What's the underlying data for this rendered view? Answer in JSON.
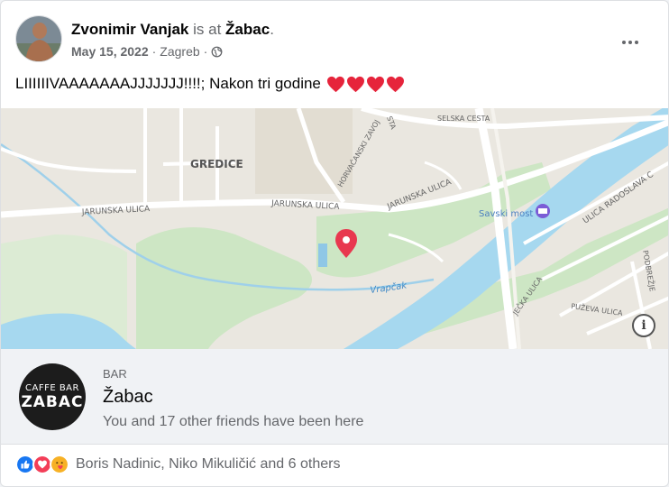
{
  "post": {
    "author": "Zvonimir Vanjak",
    "is_at": "is at",
    "place": "Žabac",
    "period": ".",
    "date": "May 15, 2022",
    "separator": "·",
    "city": "Zagreb",
    "separator2": "·",
    "text": "LIIIIIIVAAAAAAAJJJJJJJ!!!!; Nakon tri godine",
    "hearts_count": 4
  },
  "map": {
    "labels": {
      "gredice": "GREDICE",
      "jarunska1": "JARUNSKA ULICA",
      "jarunska2": "JARUNSKA ULICA",
      "jarunska3": "JARUNSKA ULICA",
      "selska": "SELSKA CESTA",
      "horvacanski": "HORVAĆANSKI ZAVOJ",
      "savski_most": "Savski most",
      "radoslava": "ULICA RADOSLAVA C",
      "jecka": "JEČKA ULICA",
      "puzeva": "PUŽEVA ULICA",
      "podbrezje": "PODBREŽJE",
      "vrapcak": "Vrapčak",
      "sta": "STA"
    },
    "info_label": "i"
  },
  "place_card": {
    "category": "BAR",
    "name": "Žabac",
    "friends_text": "You and 17 other friends have been here",
    "logo_line1": "CAFFE BAR",
    "logo_line2": "ZABAC"
  },
  "reactions": {
    "icons": [
      "like-icon",
      "love-icon",
      "care-icon"
    ],
    "text": "Boris Nadinic, Niko Mikuličić and 6 others"
  },
  "colors": {
    "river": "#a6d8ef",
    "park": "#cde6c4",
    "pin": "#e8384f",
    "like": "#1877f2",
    "love": "#f33e58",
    "care": "#f7b125"
  }
}
